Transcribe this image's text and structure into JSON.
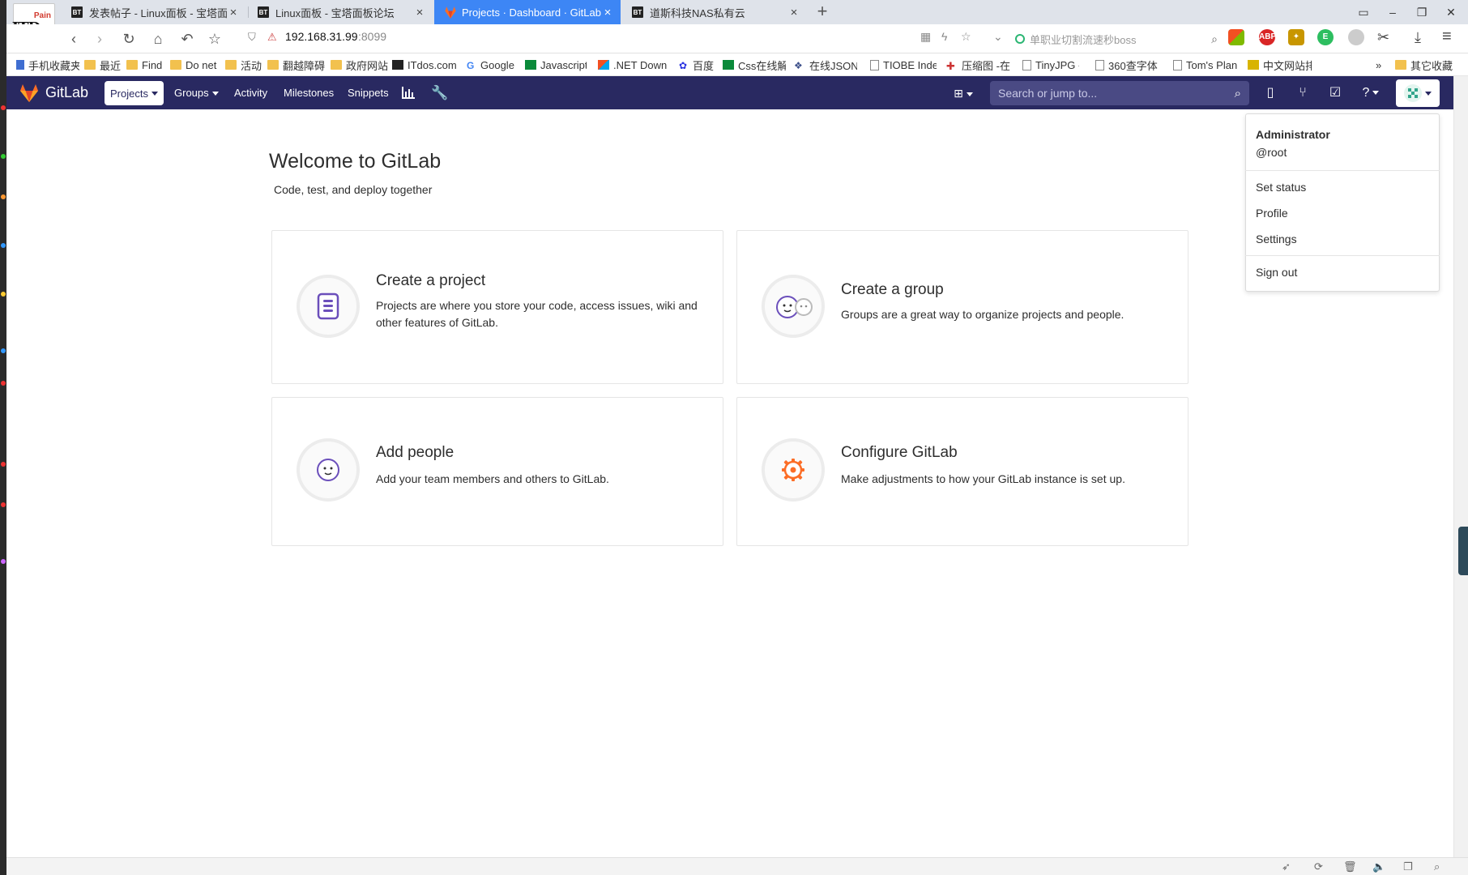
{
  "browser": {
    "logo_small": "Pain",
    "logo_main": "ITDos",
    "tabs": [
      {
        "favicon": "BT",
        "title": "发表帖子 - Linux面板 - 宝塔面板",
        "close": "×"
      },
      {
        "favicon": "BT",
        "title": "Linux面板 - 宝塔面板论坛",
        "close": "×"
      },
      {
        "favicon": "gitlab-fox",
        "title": "Projects · Dashboard · GitLab",
        "close": "×"
      },
      {
        "favicon": "BT",
        "title": "道斯科技NAS私有云",
        "close": "×"
      }
    ],
    "new_tab": "+",
    "window_buttons": [
      "▭",
      "–",
      "❐",
      "✕"
    ],
    "address": {
      "host": "192.168.31.99",
      "port": ":8099"
    },
    "search_hint": "单职业切割流速秒boss",
    "bookmarks": [
      "手机收藏夹",
      "最近",
      "Find",
      "Do net",
      "活动",
      "翻越障碍",
      "政府网站",
      "ITdos.com",
      "Google",
      "Javascript",
      ".NET Down",
      "百度",
      "Css在线解",
      "在线JSON",
      "TIOBE Inde",
      "压缩图 -在",
      "TinyJPG -",
      "360查字体",
      "Tom's Plan",
      "中文网站排",
      "其它收藏"
    ],
    "bookmarks_overflow": "»"
  },
  "gitlab": {
    "brand": "GitLab",
    "nav": {
      "projects": "Projects",
      "groups": "Groups",
      "activity": "Activity",
      "milestones": "Milestones",
      "snippets": "Snippets"
    },
    "search_placeholder": "Search or jump to...",
    "colors": {
      "header": "#292961",
      "accent": "#6b4fbb",
      "orange": "#fc6d26"
    }
  },
  "main": {
    "title": "Welcome to GitLab",
    "subtitle": "Code, test, and deploy together",
    "cards": [
      {
        "title": "Create a project",
        "desc": "Projects are where you store your code, access issues, wiki and other features of GitLab.",
        "icon": "project-icon"
      },
      {
        "title": "Create a group",
        "desc": "Groups are a great way to organize projects and people.",
        "icon": "group-icon"
      },
      {
        "title": "Add people",
        "desc": "Add your team members and others to GitLab.",
        "icon": "people-icon"
      },
      {
        "title": "Configure GitLab",
        "desc": "Make adjustments to how your GitLab instance is set up.",
        "icon": "gear-icon"
      }
    ]
  },
  "user_menu": {
    "name": "Administrator",
    "username": "@root",
    "items": [
      "Set status",
      "Profile",
      "Settings"
    ],
    "sign_out": "Sign out"
  }
}
